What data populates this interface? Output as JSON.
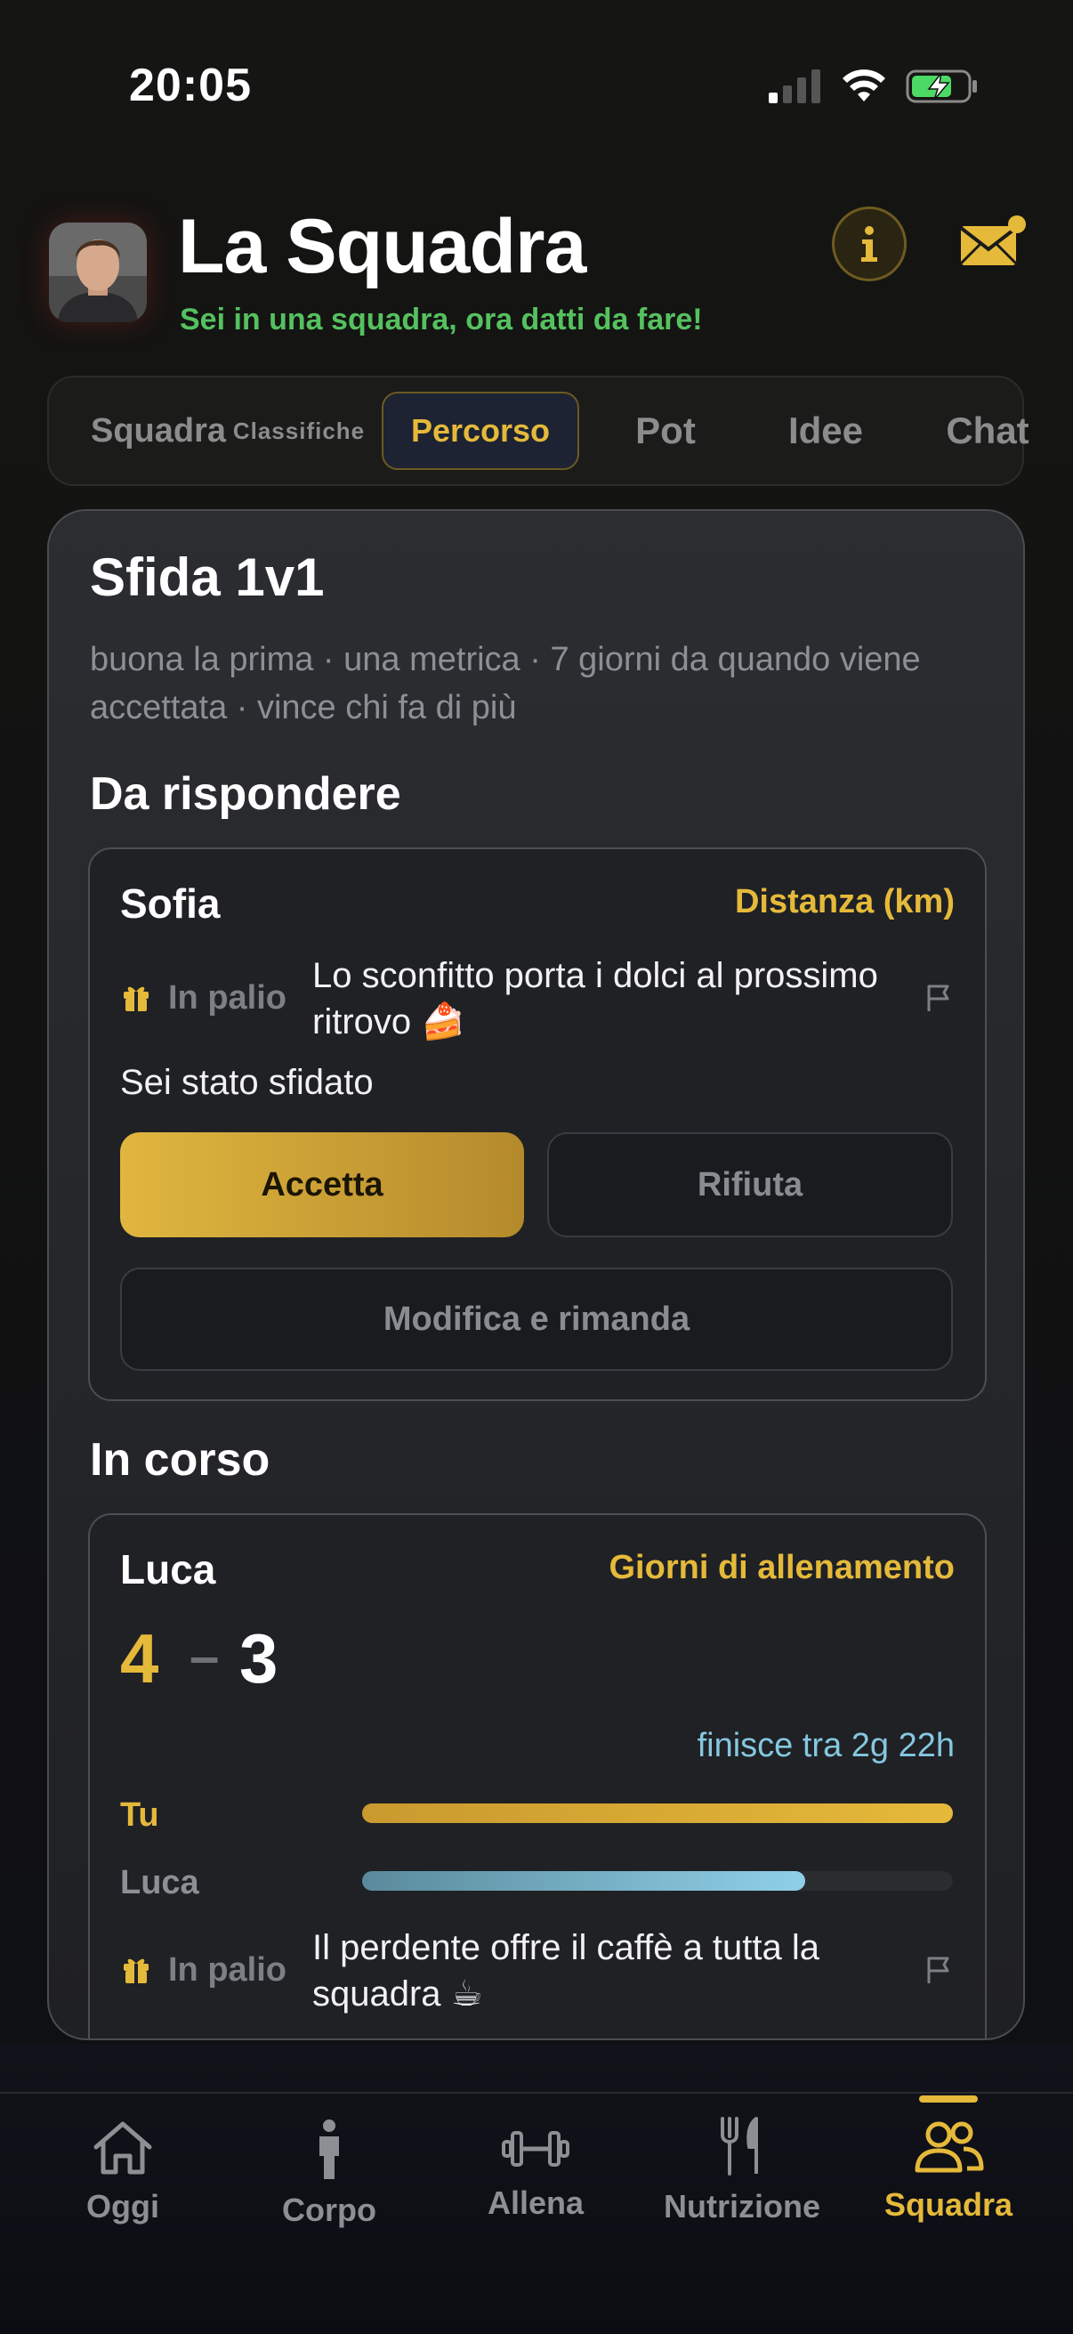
{
  "status_bar": {
    "time": "20:05"
  },
  "header": {
    "title": "La Squadra",
    "subtitle": "Sei in una squadra, ora datti da fare!"
  },
  "tabs": [
    {
      "label": "Squadra"
    },
    {
      "label": "Classifiche"
    },
    {
      "label": "Percorso",
      "active": true
    },
    {
      "label": "Pot"
    },
    {
      "label": "Idee"
    },
    {
      "label": "Chat"
    }
  ],
  "challenge": {
    "title": "Sfida 1v1",
    "description": "buona la prima · una metrica · 7 giorni da quando viene accettata · vince chi fa di più",
    "to_answer_heading": "Da rispondere",
    "pending": {
      "opponent": "Sofia",
      "metric": "Distanza (km)",
      "prize_label": "In palio",
      "prize_text": "Lo sconfitto porta i dolci al prossimo ritrovo 🍰",
      "status": "Sei stato sfidato",
      "accept_label": "Accetta",
      "reject_label": "Rifiuta",
      "modify_label": "Modifica e rimanda"
    },
    "ongoing_heading": "In corso",
    "ongoing": {
      "opponent": "Luca",
      "metric": "Giorni di allenamento",
      "score_me": "4",
      "score_sep": "–",
      "score_opponent": "3",
      "ends_in": "finisce tra 2g 22h",
      "me_label": "Tu",
      "opponent_label": "Luca",
      "me_progress": 1.0,
      "opponent_progress": 0.75,
      "prize_label": "In palio",
      "prize_text": "Il perdente offre il caffè a tutta la squadra ☕"
    }
  },
  "tabbar": [
    {
      "label": "Oggi",
      "icon": "home-icon"
    },
    {
      "label": "Corpo",
      "icon": "person-icon"
    },
    {
      "label": "Allena",
      "icon": "dumbbell-icon"
    },
    {
      "label": "Nutrizione",
      "icon": "utensils-icon"
    },
    {
      "label": "Squadra",
      "icon": "people-icon",
      "active": true
    }
  ],
  "colors": {
    "accent": "#e5b93a",
    "green": "#55c15f",
    "blue": "#86c7e0"
  }
}
